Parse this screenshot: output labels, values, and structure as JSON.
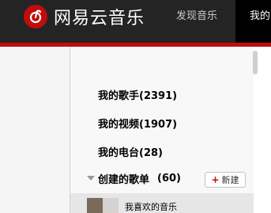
{
  "header": {
    "brand": "网易云音乐",
    "nav": {
      "discover": "发现音乐",
      "mine": "我的"
    }
  },
  "sidebar": {
    "links": [
      {
        "label": "我的歌手",
        "count": "(2391)"
      },
      {
        "label": "我的视频",
        "count": "(1907)"
      },
      {
        "label": "我的电台",
        "count": "(28)"
      }
    ],
    "created": {
      "title": "创建的歌单",
      "count": "(60)",
      "new_button": "新建"
    },
    "playlists": [
      {
        "name": "我喜欢的音乐"
      }
    ]
  },
  "colors": {
    "brand_red": "#c20c0c",
    "topbar": "#242424"
  }
}
